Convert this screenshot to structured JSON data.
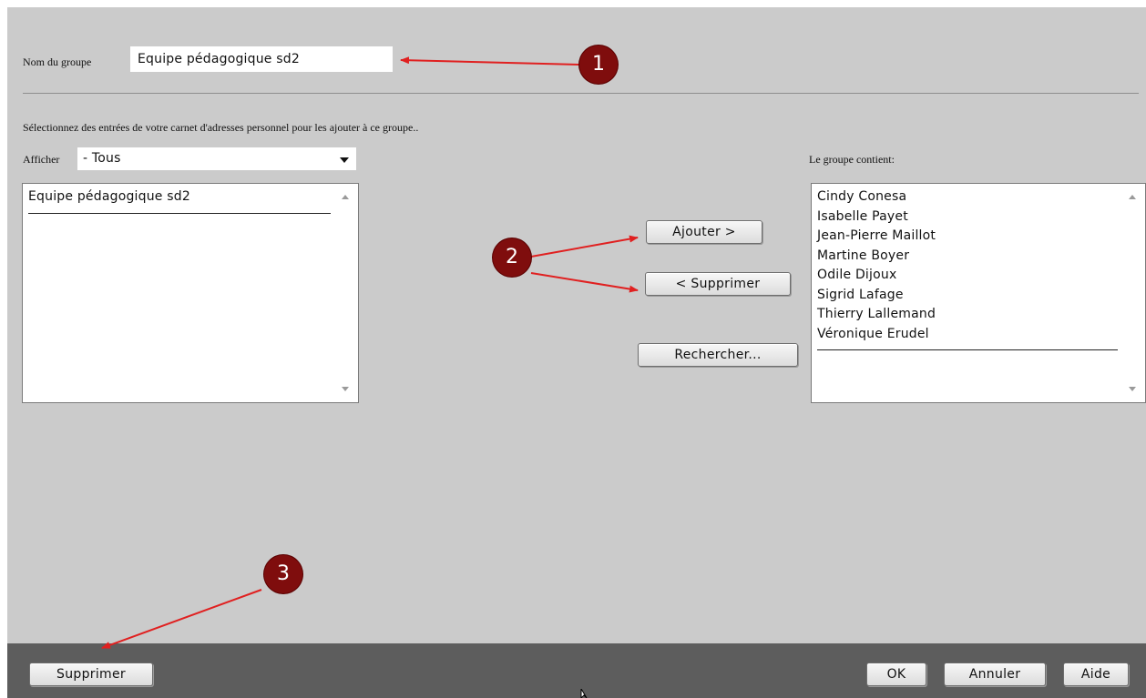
{
  "group": {
    "name_label": "Nom du groupe",
    "name_value": "Equipe pédagogique sd2"
  },
  "instruction": "Sélectionnez des entrées de votre carnet d'adresses personnel pour les ajouter à ce groupe..",
  "filter": {
    "label": "Afficher",
    "selected": "- Tous"
  },
  "source_list": {
    "items": [
      "Equipe pédagogique sd2"
    ]
  },
  "group_contents": {
    "label": "Le groupe contient:",
    "members": [
      "Cindy Conesa",
      "Isabelle Payet",
      "Jean-Pierre Maillot",
      "Martine Boyer",
      "Odile Dijoux",
      "Sigrid Lafage",
      "Thierry Lallemand",
      "Véronique Erudel"
    ]
  },
  "buttons": {
    "add": "Ajouter >",
    "remove": "< Supprimer",
    "search": "Rechercher...",
    "delete": "Supprimer",
    "ok": "OK",
    "cancel": "Annuler",
    "help": "Aide"
  },
  "annotations": {
    "marker_1": "1",
    "marker_2": "2",
    "marker_3": "3",
    "color": "#7f0d0d",
    "arrow_color": "#e02020"
  }
}
